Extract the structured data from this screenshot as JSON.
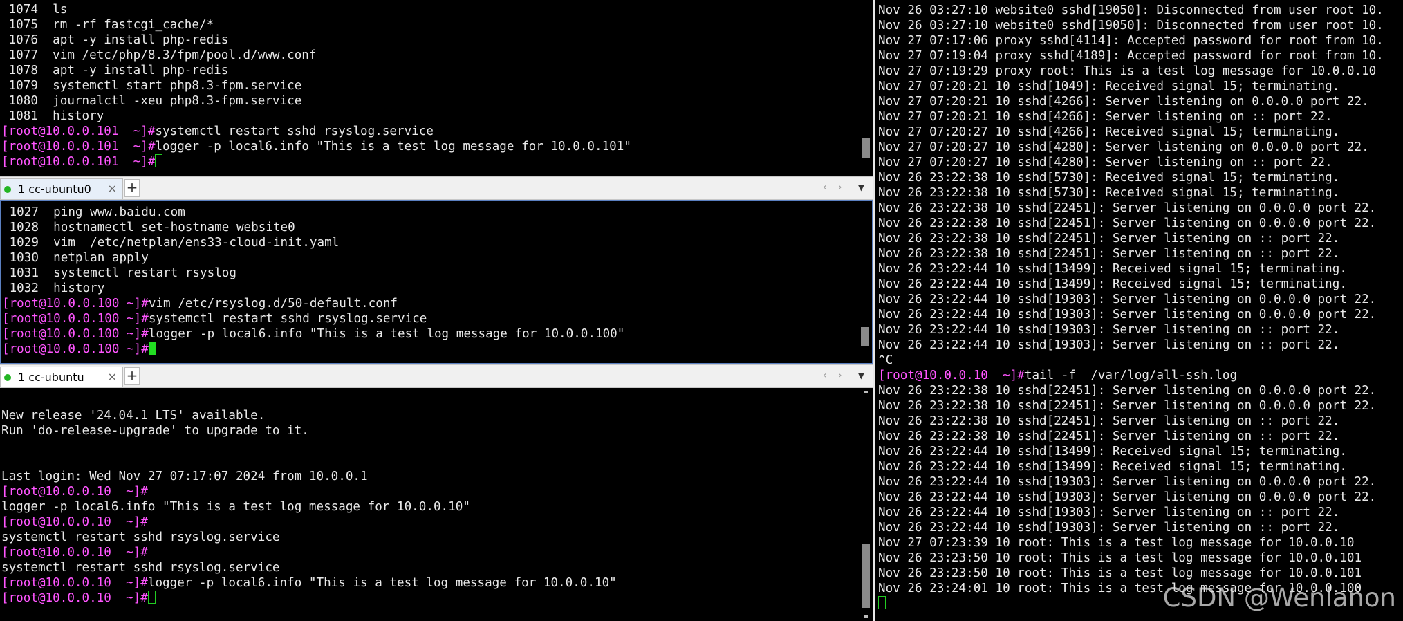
{
  "top_pane": {
    "lines": [
      {
        "text": " 1074  ls"
      },
      {
        "text": " 1075  rm -rf fastcgi_cache/*"
      },
      {
        "text": " 1076  apt -y install php-redis"
      },
      {
        "text": " 1077  vim /etc/php/8.3/fpm/pool.d/www.conf"
      },
      {
        "text": " 1078  apt -y install php-redis"
      },
      {
        "text": " 1079  systemctl start php8.3-fpm.service"
      },
      {
        "text": " 1080  journalctl -xeu php8.3-fpm.service"
      },
      {
        "text": " 1081  history"
      },
      {
        "prompt": "[root@10.0.0.101  ~]#",
        "text": "systemctl restart sshd rsyslog.service"
      },
      {
        "prompt": "[root@10.0.0.101  ~]#",
        "text": "logger -p local6.info \"This is a test log message for 10.0.0.101\""
      },
      {
        "prompt": "[root@10.0.0.101  ~]#",
        "text": "",
        "cursor": "hollow"
      }
    ]
  },
  "middle_tabbar": {
    "tab_number": "1",
    "tab_name": " cc-ubuntu0",
    "close_glyph": "×",
    "new_tab_glyph": "+",
    "nav_left": "‹",
    "nav_right": "›",
    "menu_glyph": "▼"
  },
  "middle_pane": {
    "lines": [
      {
        "text": " 1027  ping www.baidu.com"
      },
      {
        "text": " 1028  hostnamectl set-hostname website0"
      },
      {
        "text": " 1029  vim  /etc/netplan/ens33-cloud-init.yaml"
      },
      {
        "text": " 1030  netplan apply"
      },
      {
        "text": " 1031  systemctl restart rsyslog"
      },
      {
        "text": " 1032  history"
      },
      {
        "prompt": "[root@10.0.0.100 ~]#",
        "text": "vim /etc/rsyslog.d/50-default.conf"
      },
      {
        "prompt": "[root@10.0.0.100 ~]#",
        "text": "systemctl restart sshd rsyslog.service"
      },
      {
        "prompt": "[root@10.0.0.100 ~]#",
        "text": "logger -p local6.info \"This is a test log message for 10.0.0.100\""
      },
      {
        "prompt": "[root@10.0.0.100 ~]#",
        "text": "",
        "cursor": "solid"
      }
    ]
  },
  "bottom_tabbar": {
    "tab_number": "1",
    "tab_name": " cc-ubuntu",
    "close_glyph": "×",
    "new_tab_glyph": "+",
    "nav_left": "‹",
    "nav_right": "›",
    "menu_glyph": "▼"
  },
  "bottom_pane": {
    "lines": [
      {
        "text": ""
      },
      {
        "text": "New release '24.04.1 LTS' available."
      },
      {
        "text": "Run 'do-release-upgrade' to upgrade to it."
      },
      {
        "text": ""
      },
      {
        "text": ""
      },
      {
        "text": "Last login: Wed Nov 27 07:17:07 2024 from 10.0.0.1"
      },
      {
        "prompt": "[root@10.0.0.10  ~]#",
        "text": ""
      },
      {
        "text": "logger -p local6.info \"This is a test log message for 10.0.0.10\""
      },
      {
        "prompt": "[root@10.0.0.10  ~]#",
        "text": ""
      },
      {
        "text": "systemctl restart sshd rsyslog.service"
      },
      {
        "prompt": "[root@10.0.0.10  ~]#",
        "text": ""
      },
      {
        "text": "systemctl restart sshd rsyslog.service"
      },
      {
        "prompt": "[root@10.0.0.10  ~]#",
        "text": "logger -p local6.info \"This is a test log message for 10.0.0.10\""
      },
      {
        "prompt": "[root@10.0.0.10  ~]#",
        "text": "",
        "cursor": "hollow"
      }
    ]
  },
  "right_pane": {
    "lines": [
      {
        "text": "Nov 26 03:27:10 website0 sshd[19050]: Disconnected from user root 10."
      },
      {
        "text": "Nov 26 03:27:10 website0 sshd[19050]: Disconnected from user root 10."
      },
      {
        "text": "Nov 27 07:17:06 proxy sshd[4114]: Accepted password for root from 10."
      },
      {
        "text": "Nov 27 07:19:04 proxy sshd[4189]: Accepted password for root from 10."
      },
      {
        "text": "Nov 27 07:19:29 proxy root: This is a test log message for 10.0.0.10"
      },
      {
        "text": "Nov 27 07:20:21 10 sshd[1049]: Received signal 15; terminating."
      },
      {
        "text": "Nov 27 07:20:21 10 sshd[4266]: Server listening on 0.0.0.0 port 22."
      },
      {
        "text": "Nov 27 07:20:21 10 sshd[4266]: Server listening on :: port 22."
      },
      {
        "text": "Nov 27 07:20:27 10 sshd[4266]: Received signal 15; terminating."
      },
      {
        "text": "Nov 27 07:20:27 10 sshd[4280]: Server listening on 0.0.0.0 port 22."
      },
      {
        "text": "Nov 27 07:20:27 10 sshd[4280]: Server listening on :: port 22."
      },
      {
        "text": "Nov 26 23:22:38 10 sshd[5730]: Received signal 15; terminating."
      },
      {
        "text": "Nov 26 23:22:38 10 sshd[5730]: Received signal 15; terminating."
      },
      {
        "text": "Nov 26 23:22:38 10 sshd[22451]: Server listening on 0.0.0.0 port 22."
      },
      {
        "text": "Nov 26 23:22:38 10 sshd[22451]: Server listening on 0.0.0.0 port 22."
      },
      {
        "text": "Nov 26 23:22:38 10 sshd[22451]: Server listening on :: port 22."
      },
      {
        "text": "Nov 26 23:22:38 10 sshd[22451]: Server listening on :: port 22."
      },
      {
        "text": "Nov 26 23:22:44 10 sshd[13499]: Received signal 15; terminating."
      },
      {
        "text": "Nov 26 23:22:44 10 sshd[13499]: Received signal 15; terminating."
      },
      {
        "text": "Nov 26 23:22:44 10 sshd[19303]: Server listening on 0.0.0.0 port 22."
      },
      {
        "text": "Nov 26 23:22:44 10 sshd[19303]: Server listening on 0.0.0.0 port 22."
      },
      {
        "text": "Nov 26 23:22:44 10 sshd[19303]: Server listening on :: port 22."
      },
      {
        "text": "Nov 26 23:22:44 10 sshd[19303]: Server listening on :: port 22."
      },
      {
        "text": "^C"
      },
      {
        "prompt": "[root@10.0.0.10  ~]#",
        "text": "tail -f  /var/log/all-ssh.log"
      },
      {
        "text": "Nov 26 23:22:38 10 sshd[22451]: Server listening on 0.0.0.0 port 22."
      },
      {
        "text": "Nov 26 23:22:38 10 sshd[22451]: Server listening on 0.0.0.0 port 22."
      },
      {
        "text": "Nov 26 23:22:38 10 sshd[22451]: Server listening on :: port 22."
      },
      {
        "text": "Nov 26 23:22:38 10 sshd[22451]: Server listening on :: port 22."
      },
      {
        "text": "Nov 26 23:22:44 10 sshd[13499]: Received signal 15; terminating."
      },
      {
        "text": "Nov 26 23:22:44 10 sshd[13499]: Received signal 15; terminating."
      },
      {
        "text": "Nov 26 23:22:44 10 sshd[19303]: Server listening on 0.0.0.0 port 22."
      },
      {
        "text": "Nov 26 23:22:44 10 sshd[19303]: Server listening on 0.0.0.0 port 22."
      },
      {
        "text": "Nov 26 23:22:44 10 sshd[19303]: Server listening on :: port 22."
      },
      {
        "text": "Nov 26 23:22:44 10 sshd[19303]: Server listening on :: port 22."
      },
      {
        "text": "Nov 27 07:23:39 10 root: This is a test log message for 10.0.0.10"
      },
      {
        "text": "Nov 26 23:23:50 10 root: This is a test log message for 10.0.0.101"
      },
      {
        "text": "Nov 26 23:23:50 10 root: This is a test log message for 10.0.0.101"
      },
      {
        "text": "Nov 26 23:24:01 10 root: This is a test log message for 10.0.0.100"
      },
      {
        "text": "",
        "cursor": "hollow"
      }
    ]
  },
  "watermark": "CSDN @Wenlanon",
  "colors": {
    "prompt": "#ff55ff",
    "output": "#e8e8e8",
    "cursor": "#22cc22",
    "background": "#000000"
  }
}
